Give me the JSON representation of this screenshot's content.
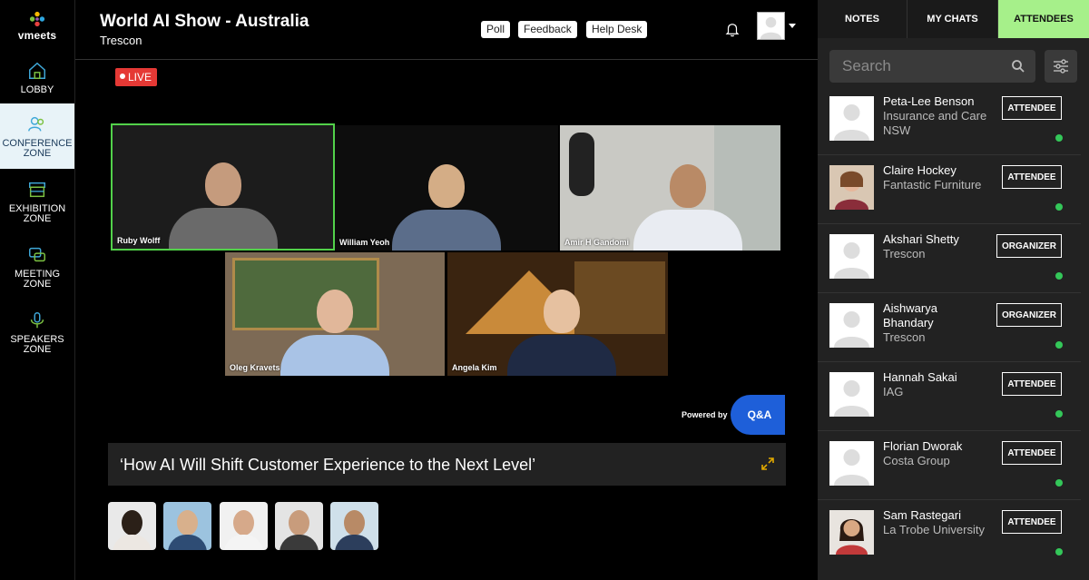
{
  "app": {
    "logo_text": "vmeets"
  },
  "nav": [
    {
      "label": "LOBBY",
      "icon": "home-icon"
    },
    {
      "label": "CONFERENCE\nZONE",
      "icon": "conference-icon",
      "active": true
    },
    {
      "label": "EXHIBITION\nZONE",
      "icon": "exhibition-icon"
    },
    {
      "label": "MEETING\nZONE",
      "icon": "meeting-icon"
    },
    {
      "label": "SPEAKERS\nZONE",
      "icon": "microphone-icon"
    }
  ],
  "header": {
    "title": "World AI Show - Australia",
    "organizer": "Trescon",
    "buttons": [
      "Poll",
      "Feedback",
      "Help Desk"
    ]
  },
  "stream": {
    "live_label": "LIVE",
    "participants": [
      "Ruby Wolff",
      "William Yeoh",
      "Amir H Gandomi",
      "Oleg Kravets",
      "Angela Kim"
    ],
    "powered_by": "Powered by",
    "qa_label": "Q&A"
  },
  "session": {
    "title": "‘How AI Will Shift Customer Experience to the Next Level’"
  },
  "panel": {
    "tabs": [
      "NOTES",
      "MY CHATS",
      "ATTENDEES"
    ],
    "active_tab": "ATTENDEES",
    "search_placeholder": "Search",
    "attendees": [
      {
        "name": "Peta-Lee Benson",
        "org": "Insurance and Care NSW",
        "role": "ATTENDEE",
        "online": true
      },
      {
        "name": "Claire Hockey",
        "org": "Fantastic Furniture",
        "role": "ATTENDEE",
        "online": true
      },
      {
        "name": "Akshari Shetty",
        "org": "Trescon",
        "role": "ORGANIZER",
        "online": true
      },
      {
        "name": "Aishwarya Bhandary",
        "org": "Trescon",
        "role": "ORGANIZER",
        "online": true
      },
      {
        "name": "Hannah Sakai",
        "org": "IAG",
        "role": "ATTENDEE",
        "online": true
      },
      {
        "name": "Florian Dworak",
        "org": "Costa Group",
        "role": "ATTENDEE",
        "online": true
      },
      {
        "name": "Sam Rastegari",
        "org": "La Trobe University",
        "role": "ATTENDEE",
        "online": true
      }
    ]
  },
  "colors": {
    "accent_green": "#a6f08a",
    "live_red": "#e53935",
    "qa_blue": "#1e5fd9",
    "online_green": "#34c759"
  }
}
